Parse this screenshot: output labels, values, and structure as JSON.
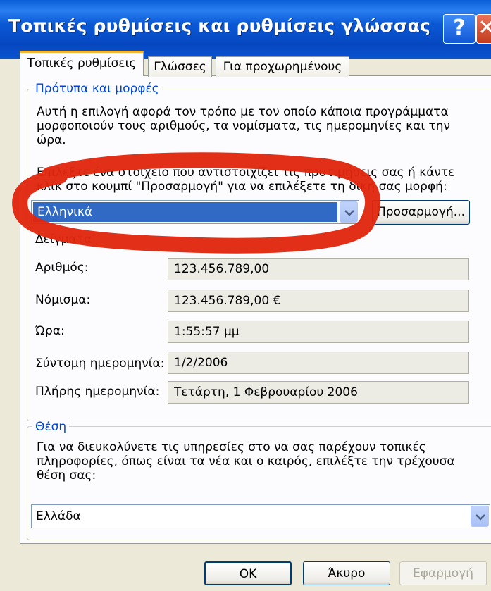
{
  "window": {
    "title": "Τοπικές ρυθμίσεις και ρυθμίσεις γλώσσας",
    "help_label": "?",
    "close_label": "✕"
  },
  "tabs": [
    {
      "label": "Τοπικές ρυθμίσεις",
      "active": true
    },
    {
      "label": "Γλώσσες",
      "active": false
    },
    {
      "label": "Για προχωρημένους",
      "active": false
    }
  ],
  "formats": {
    "legend": "Πρότυπα και μορφές",
    "description": "Αυτή η επιλογή αφορά τον τρόπο με τον οποίο κάποια προγράμματα μορφοποιούν τους αριθμούς, τα νομίσματα, τις ημερομηνίες και την ώρα.",
    "instruction": "Επιλέξτε ένα στοιχείο που αντιστοιχίζει τις προτιμήσεις σας ή κάντε κλικ στο κουμπί \"Προσαρμογή\" για να επιλέξετε τη δική σας μορφή:",
    "selected": "Ελληνικά",
    "customize_label": "Προσαρμογή...",
    "samples_label": "Δείγματα",
    "samples": [
      {
        "label": "Αριθμός:",
        "value": "123.456.789,00"
      },
      {
        "label": "Νόμισμα:",
        "value": "123.456.789,00 €"
      },
      {
        "label": "Ώρα:",
        "value": "1:55:57 μμ"
      },
      {
        "label": "Σύντομη ημερομηνία:",
        "value": "1/2/2006"
      },
      {
        "label": "Πλήρης ημερομηνία:",
        "value": "Τετάρτη, 1 Φεβρουαρίου 2006"
      }
    ]
  },
  "location": {
    "legend": "Θέση",
    "description": "Για να διευκολύνετε τις υπηρεσίες στο να σας παρέχουν τοπικές πληροφορίες, όπως είναι τα νέα και ο καιρός, επιλέξτε την τρέχουσα θέση σας:",
    "selected": "Ελλάδα"
  },
  "buttons": {
    "ok": "OK",
    "cancel": "Άκυρο",
    "apply": "Εφαρμογή"
  },
  "colors": {
    "titlebar": "#0a54d0",
    "selection": "#316ac5",
    "legend_text": "#0046d5",
    "annotation": "#e0260f"
  }
}
